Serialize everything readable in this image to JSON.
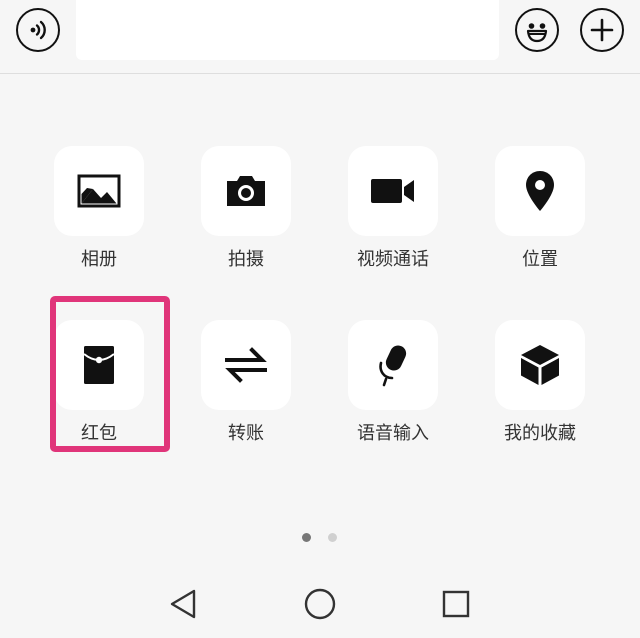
{
  "topbar": {
    "voice_icon": "voice-wave-icon",
    "input_value": "",
    "input_placeholder": "",
    "emoji_icon": "smiley-icon",
    "plus_icon": "plus-icon"
  },
  "panel": {
    "items": [
      {
        "label": "相册",
        "icon": "image-icon"
      },
      {
        "label": "拍摄",
        "icon": "camera-icon"
      },
      {
        "label": "视频通话",
        "icon": "video-camera-icon"
      },
      {
        "label": "位置",
        "icon": "location-pin-icon"
      },
      {
        "label": "红包",
        "icon": "red-envelope-icon"
      },
      {
        "label": "转账",
        "icon": "transfer-arrows-icon"
      },
      {
        "label": "语音输入",
        "icon": "microphone-icon"
      },
      {
        "label": "我的收藏",
        "icon": "cube-icon"
      }
    ],
    "highlighted_item": "红包"
  },
  "pagination": {
    "total_pages": 2,
    "current_page": 1
  },
  "colors": {
    "highlight_border": "#e0357a",
    "icon": "#111111",
    "tile_bg": "#ffffff",
    "page_bg": "#f6f6f6",
    "dot_active": "#777777",
    "dot_inactive": "#d0d0d0"
  },
  "navbar": {
    "back_icon": "triangle-back-icon",
    "home_icon": "circle-home-icon",
    "recents_icon": "square-recents-icon"
  }
}
